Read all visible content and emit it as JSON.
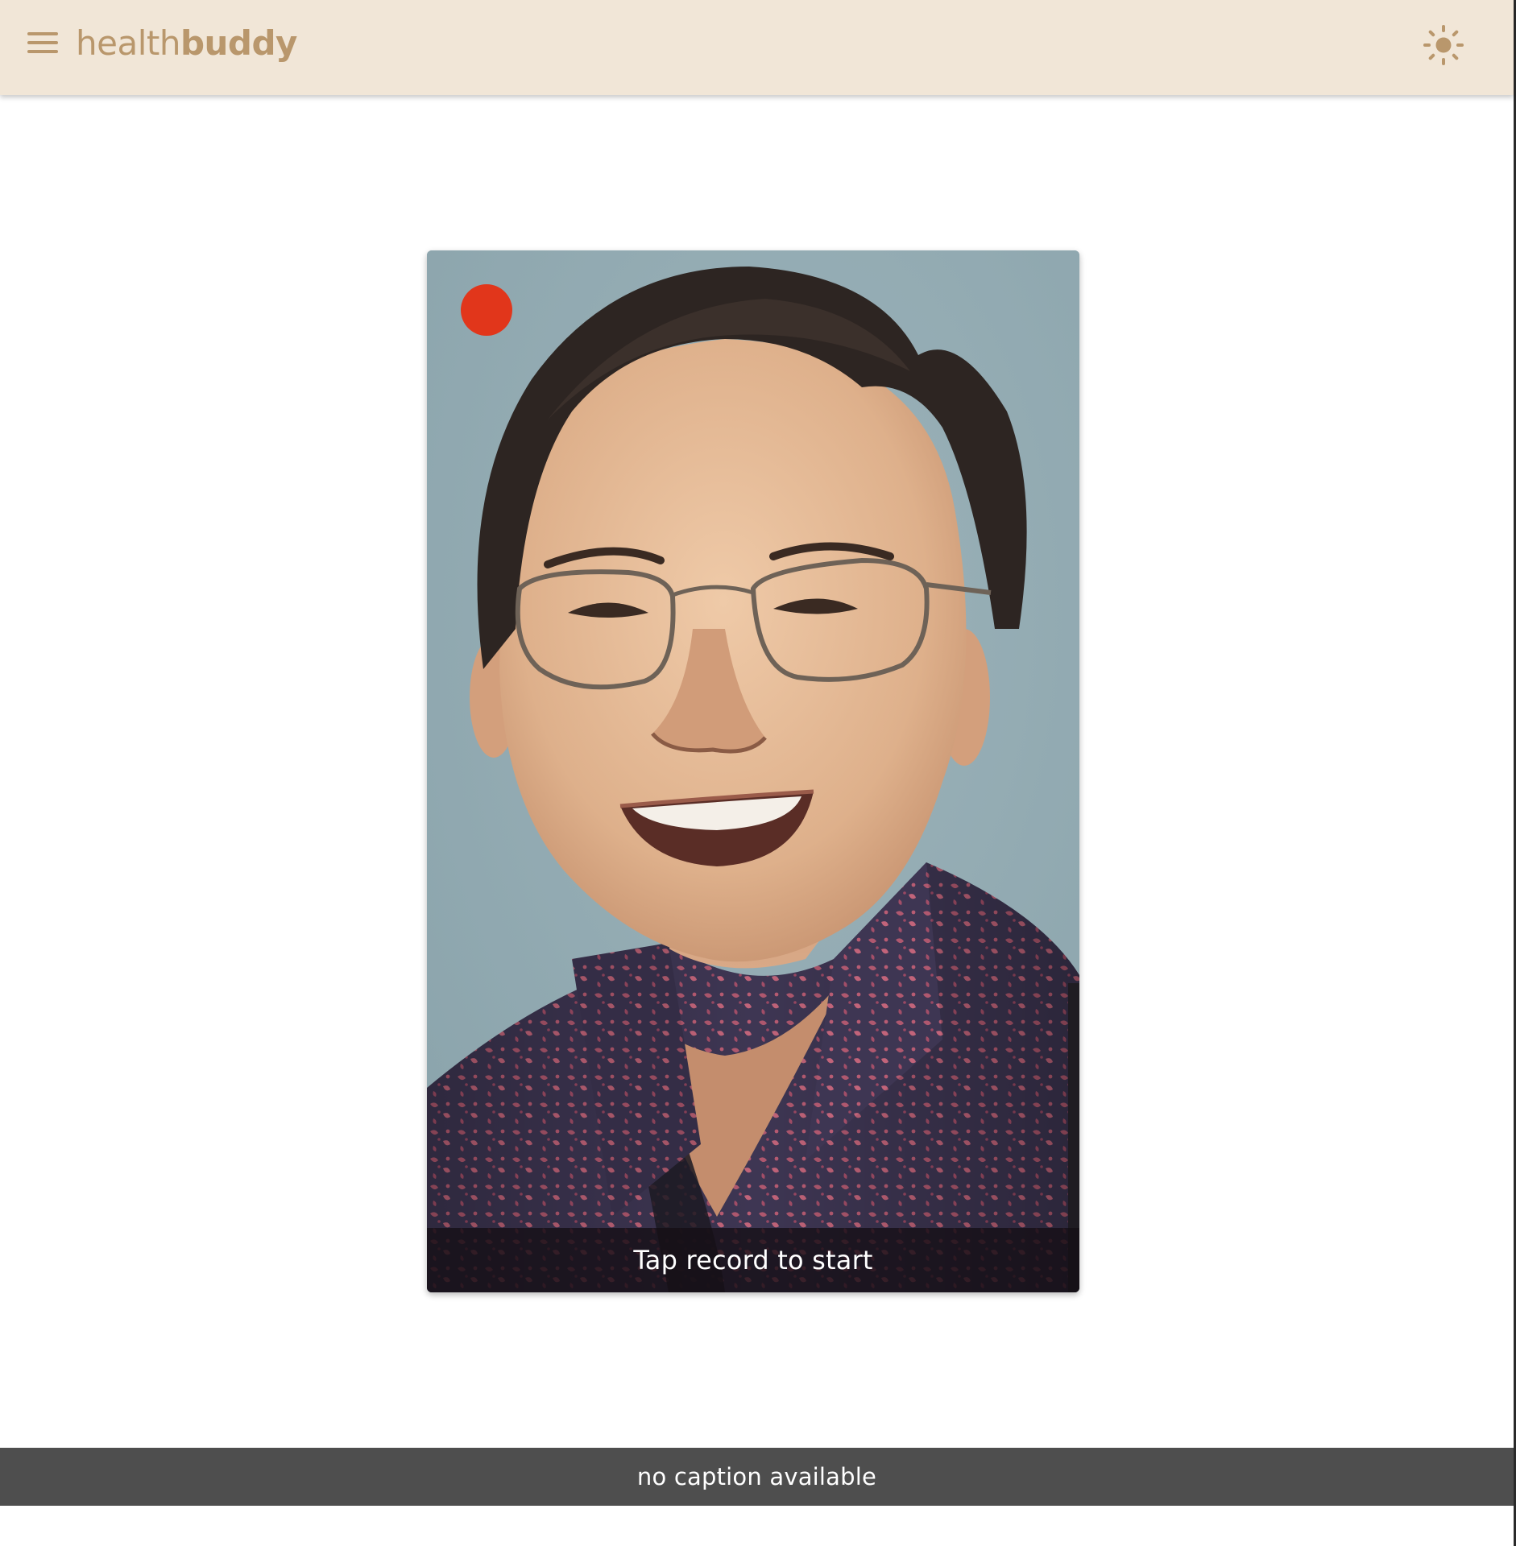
{
  "header": {
    "menu_icon": "hamburger-menu-icon",
    "logo_light": "health",
    "logo_bold": "buddy",
    "theme_icon": "sun-icon",
    "background_color": "#f1e6d7",
    "accent_color": "#b9976c"
  },
  "video": {
    "record_button_color": "#e1361b",
    "status_text": "Tap record to start"
  },
  "caption": {
    "text": "no caption available"
  }
}
